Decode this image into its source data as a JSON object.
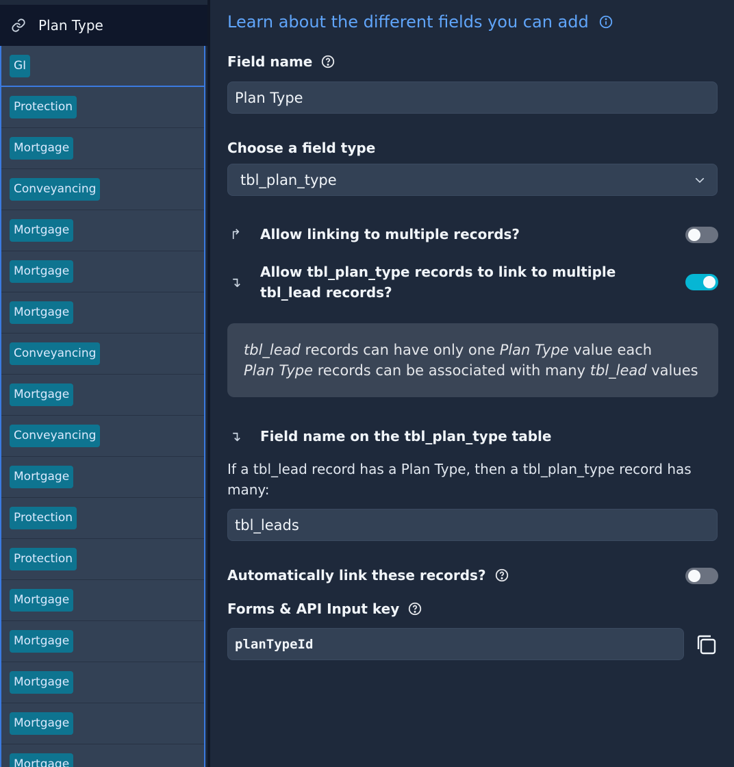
{
  "column": {
    "header": "Plan Type",
    "cells": [
      "GI",
      "Protection",
      "Mortgage",
      "Conveyancing",
      "Mortgage",
      "Mortgage",
      "Mortgage",
      "Conveyancing",
      "Mortgage",
      "Conveyancing",
      "Mortgage",
      "Protection",
      "Protection",
      "Mortgage",
      "Mortgage",
      "Mortgage",
      "Mortgage",
      "Mortgage"
    ]
  },
  "panel": {
    "learn_link": "Learn about the different fields you can add",
    "field_name_label": "Field name",
    "field_name_value": "Plan Type",
    "field_type_label": "Choose a field type",
    "field_type_value": "tbl_plan_type",
    "allow_multiple_label": "Allow linking to multiple records?",
    "allow_multiple_on": false,
    "allow_reverse_label": "Allow tbl_plan_type records to link to multiple tbl_lead records?",
    "allow_reverse_on": true,
    "info": {
      "line1_a": "tbl_lead",
      "line1_b": " records can have only one ",
      "line1_c": "Plan Type",
      "line1_d": " value each",
      "line2_a": "Plan Type",
      "line2_b": " records can be associated with many ",
      "line2_c": "tbl_lead",
      "line2_d": " values"
    },
    "reverse_field_label": "Field name on the tbl_plan_type table",
    "reverse_desc": "If a tbl_lead record has a Plan Type, then a tbl_plan_type record has many:",
    "reverse_field_value": "tbl_leads",
    "auto_link_label": "Automatically link these records?",
    "auto_link_on": false,
    "api_key_label": "Forms & API Input key",
    "api_key_value": "planTypeId"
  },
  "colors": {
    "accent": "#3b7ae0",
    "chip": "#0e7490",
    "toggle_on": "#06b6d4",
    "link": "#60a5fa"
  }
}
